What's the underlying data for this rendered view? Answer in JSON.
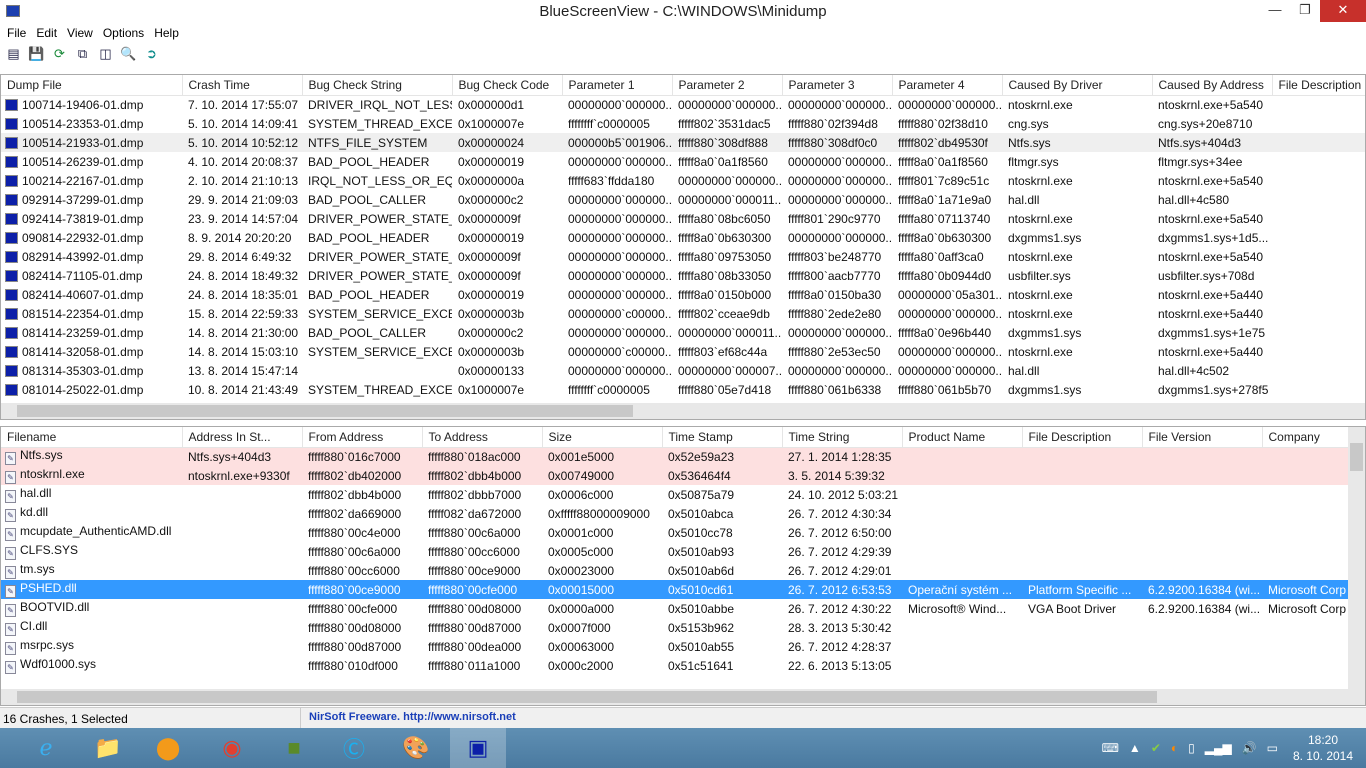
{
  "window": {
    "title": "BlueScreenView  -  C:\\WINDOWS\\Minidump",
    "controls": [
      "minimize",
      "restore",
      "close"
    ]
  },
  "menu": [
    "File",
    "Edit",
    "View",
    "Options",
    "Help"
  ],
  "toolbar": [
    {
      "icon": "html-report-icon"
    },
    {
      "icon": "save-icon"
    },
    {
      "icon": "refresh-icon"
    },
    {
      "icon": "copy-icon"
    },
    {
      "icon": "properties-icon"
    },
    {
      "icon": "find-icon"
    },
    {
      "icon": "exit-icon"
    }
  ],
  "crashes": {
    "columns": [
      "Dump File",
      "Crash Time",
      "Bug Check String",
      "Bug Check Code",
      "Parameter 1",
      "Parameter 2",
      "Parameter 3",
      "Parameter 4",
      "Caused By Driver",
      "Caused By Address",
      "File Description"
    ],
    "sort_column": "Crash Time",
    "rows": [
      [
        "100714-19406-01.dmp",
        "7. 10. 2014 17:55:07",
        "DRIVER_IRQL_NOT_LESS...",
        "0x000000d1",
        "00000000`000000...",
        "00000000`000000...",
        "00000000`000000...",
        "00000000`000000...",
        "ntoskrnl.exe",
        "ntoskrnl.exe+5a540",
        ""
      ],
      [
        "100514-23353-01.dmp",
        "5. 10. 2014 14:09:41",
        "SYSTEM_THREAD_EXCE...",
        "0x1000007e",
        "ffffffff`c0000005",
        "fffff802`3531dac5",
        "fffff880`02f394d8",
        "fffff880`02f38d10",
        "cng.sys",
        "cng.sys+20e8710",
        ""
      ],
      [
        "100514-21933-01.dmp",
        "5. 10. 2014 10:52:12",
        "NTFS_FILE_SYSTEM",
        "0x00000024",
        "000000b5`001906...",
        "fffff880`308df888",
        "fffff880`308df0c0",
        "fffff802`db49530f",
        "Ntfs.sys",
        "Ntfs.sys+404d3",
        ""
      ],
      [
        "100514-26239-01.dmp",
        "4. 10. 2014 20:08:37",
        "BAD_POOL_HEADER",
        "0x00000019",
        "00000000`000000...",
        "fffff8a0`0a1f8560",
        "00000000`000000...",
        "fffff8a0`0a1f8560",
        "fltmgr.sys",
        "fltmgr.sys+34ee",
        ""
      ],
      [
        "100214-22167-01.dmp",
        "2. 10. 2014 21:10:13",
        "IRQL_NOT_LESS_OR_EQ...",
        "0x0000000a",
        "fffff683`ffdda180",
        "00000000`000000...",
        "00000000`000000...",
        "fffff801`7c89c51c",
        "ntoskrnl.exe",
        "ntoskrnl.exe+5a540",
        ""
      ],
      [
        "092914-37299-01.dmp",
        "29. 9. 2014 21:09:03",
        "BAD_POOL_CALLER",
        "0x000000c2",
        "00000000`000000...",
        "00000000`000011...",
        "00000000`000000...",
        "fffff8a0`1a71e9a0",
        "hal.dll",
        "hal.dll+4c580",
        ""
      ],
      [
        "092414-73819-01.dmp",
        "23. 9. 2014 14:57:04",
        "DRIVER_POWER_STATE_...",
        "0x0000009f",
        "00000000`000000...",
        "fffffa80`08bc6050",
        "fffff801`290c9770",
        "fffffa80`07113740",
        "ntoskrnl.exe",
        "ntoskrnl.exe+5a540",
        ""
      ],
      [
        "090814-22932-01.dmp",
        "8. 9. 2014 20:20:20",
        "BAD_POOL_HEADER",
        "0x00000019",
        "00000000`000000...",
        "fffff8a0`0b630300",
        "00000000`000000...",
        "fffff8a0`0b630300",
        "dxgmms1.sys",
        "dxgmms1.sys+1d5...",
        ""
      ],
      [
        "082914-43992-01.dmp",
        "29. 8. 2014 6:49:32",
        "DRIVER_POWER_STATE_...",
        "0x0000009f",
        "00000000`000000...",
        "fffffa80`09753050",
        "fffff803`be248770",
        "fffffa80`0aff3ca0",
        "ntoskrnl.exe",
        "ntoskrnl.exe+5a540",
        ""
      ],
      [
        "082414-71105-01.dmp",
        "24. 8. 2014 18:49:32",
        "DRIVER_POWER_STATE_...",
        "0x0000009f",
        "00000000`000000...",
        "fffffa80`08b33050",
        "fffff800`aacb7770",
        "fffffa80`0b0944d0",
        "usbfilter.sys",
        "usbfilter.sys+708d",
        ""
      ],
      [
        "082414-40607-01.dmp",
        "24. 8. 2014 18:35:01",
        "BAD_POOL_HEADER",
        "0x00000019",
        "00000000`000000...",
        "fffff8a0`0150b000",
        "fffff8a0`0150ba30",
        "00000000`05a301...",
        "ntoskrnl.exe",
        "ntoskrnl.exe+5a440",
        ""
      ],
      [
        "081514-22354-01.dmp",
        "15. 8. 2014 22:59:33",
        "SYSTEM_SERVICE_EXCE...",
        "0x0000003b",
        "00000000`c00000...",
        "fffff802`cceae9db",
        "fffff880`2ede2e80",
        "00000000`000000...",
        "ntoskrnl.exe",
        "ntoskrnl.exe+5a440",
        ""
      ],
      [
        "081414-23259-01.dmp",
        "14. 8. 2014 21:30:00",
        "BAD_POOL_CALLER",
        "0x000000c2",
        "00000000`000000...",
        "00000000`000011...",
        "00000000`000000...",
        "fffff8a0`0e96b440",
        "dxgmms1.sys",
        "dxgmms1.sys+1e75",
        ""
      ],
      [
        "081414-32058-01.dmp",
        "14. 8. 2014 15:03:10",
        "SYSTEM_SERVICE_EXCE...",
        "0x0000003b",
        "00000000`c00000...",
        "fffff803`ef68c44a",
        "fffff880`2e53ec50",
        "00000000`000000...",
        "ntoskrnl.exe",
        "ntoskrnl.exe+5a440",
        ""
      ],
      [
        "081314-35303-01.dmp",
        "13. 8. 2014 15:47:14",
        "",
        "0x00000133",
        "00000000`000000...",
        "00000000`000007...",
        "00000000`000000...",
        "00000000`000000...",
        "hal.dll",
        "hal.dll+4c502",
        ""
      ],
      [
        "081014-25022-01.dmp",
        "10. 8. 2014 21:43:49",
        "SYSTEM_THREAD_EXCE...",
        "0x1000007e",
        "ffffffff`c0000005",
        "fffff880`05e7d418",
        "fffff880`061b6338",
        "fffff880`061b5b70",
        "dxgmms1.sys",
        "dxgmms1.sys+278f5",
        ""
      ]
    ],
    "focused_row": 2
  },
  "drivers": {
    "columns": [
      "Filename",
      "Address In St...",
      "From Address",
      "To Address",
      "Size",
      "Time Stamp",
      "Time String",
      "Product Name",
      "File Description",
      "File Version",
      "Company"
    ],
    "sort_column": "Address In St...",
    "rows": [
      [
        "Ntfs.sys",
        "Ntfs.sys+404d3",
        "fffff880`016c7000",
        "fffff880`018ac000",
        "0x001e5000",
        "0x52e59a23",
        "27. 1. 2014 1:28:35",
        "",
        "",
        "",
        ""
      ],
      [
        "ntoskrnl.exe",
        "ntoskrnl.exe+9330f",
        "fffff802`db402000",
        "fffff802`dbb4b000",
        "0x00749000",
        "0x536464f4",
        "3. 5. 2014 5:39:32",
        "",
        "",
        "",
        ""
      ],
      [
        "hal.dll",
        "",
        "fffff802`dbb4b000",
        "fffff802`dbbb7000",
        "0x0006c000",
        "0x50875a79",
        "24. 10. 2012 5:03:21",
        "",
        "",
        "",
        ""
      ],
      [
        "kd.dll",
        "",
        "fffff802`da669000",
        "fffff082`da672000",
        "0xfffff88000009000",
        "0x5010abca",
        "26. 7. 2012 4:30:34",
        "",
        "",
        "",
        ""
      ],
      [
        "mcupdate_AuthenticAMD.dll",
        "",
        "fffff880`00c4e000",
        "fffff880`00c6a000",
        "0x0001c000",
        "0x5010cc78",
        "26. 7. 2012 6:50:00",
        "",
        "",
        "",
        ""
      ],
      [
        "CLFS.SYS",
        "",
        "fffff880`00c6a000",
        "fffff880`00cc6000",
        "0x0005c000",
        "0x5010ab93",
        "26. 7. 2012 4:29:39",
        "",
        "",
        "",
        ""
      ],
      [
        "tm.sys",
        "",
        "fffff880`00cc6000",
        "fffff880`00ce9000",
        "0x00023000",
        "0x5010ab6d",
        "26. 7. 2012 4:29:01",
        "",
        "",
        "",
        ""
      ],
      [
        "PSHED.dll",
        "",
        "fffff880`00ce9000",
        "fffff880`00cfe000",
        "0x00015000",
        "0x5010cd61",
        "26. 7. 2012 6:53:53",
        "Operační systém ...",
        "Platform Specific ...",
        "6.2.9200.16384 (wi...",
        "Microsoft Corp"
      ],
      [
        "BOOTVID.dll",
        "",
        "fffff880`00cfe000",
        "fffff880`00d08000",
        "0x0000a000",
        "0x5010abbe",
        "26. 7. 2012 4:30:22",
        "Microsoft® Wind...",
        "VGA Boot Driver",
        "6.2.9200.16384 (wi...",
        "Microsoft Corp"
      ],
      [
        "CI.dll",
        "",
        "fffff880`00d08000",
        "fffff880`00d87000",
        "0x0007f000",
        "0x5153b962",
        "28. 3. 2013 5:30:42",
        "",
        "",
        "",
        ""
      ],
      [
        "msrpc.sys",
        "",
        "fffff880`00d87000",
        "fffff880`00dea000",
        "0x00063000",
        "0x5010ab55",
        "26. 7. 2012 4:28:37",
        "",
        "",
        "",
        ""
      ],
      [
        "Wdf01000.sys",
        "",
        "fffff880`010df000",
        "fffff880`011a1000",
        "0x000c2000",
        "0x51c51641",
        "22. 6. 2013 5:13:05",
        "",
        "",
        "",
        ""
      ]
    ],
    "highlighted_rows": [
      0,
      1
    ],
    "selected_row": 7
  },
  "status": {
    "count": "16 Crashes, 1 Selected",
    "link": "NirSoft Freeware.  http://www.nirsoft.net"
  },
  "taskbar": {
    "apps": [
      "internet-explorer",
      "file-explorer",
      "app-orange",
      "chrome",
      "minecraft",
      "skype",
      "paint",
      "bluescreenview"
    ],
    "active": "bluescreenview",
    "time": "18:20",
    "date": "8. 10. 2014"
  },
  "colors": {
    "selection": "#3399ff",
    "highlight_red": "#fde0e0",
    "close_button": "#c7302b",
    "link": "#1a3fb8"
  }
}
